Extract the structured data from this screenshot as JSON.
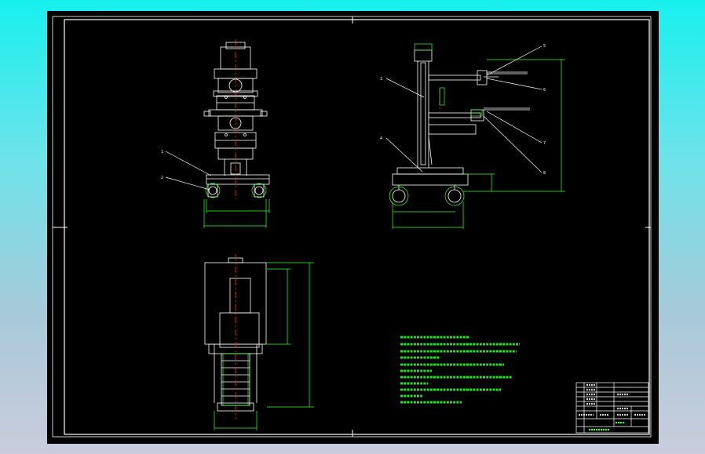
{
  "sheet": {
    "background": "#000000",
    "frame_color": "#ffffff",
    "part_color": "#ffffff",
    "dim_color": "#39ff39",
    "center_color": "#ff2a2a",
    "leader_color": "#ffffff"
  },
  "balloons": {
    "front": [
      "1",
      "2"
    ],
    "side": [
      "3",
      "4",
      "5",
      "6",
      "7",
      "8"
    ]
  }
}
